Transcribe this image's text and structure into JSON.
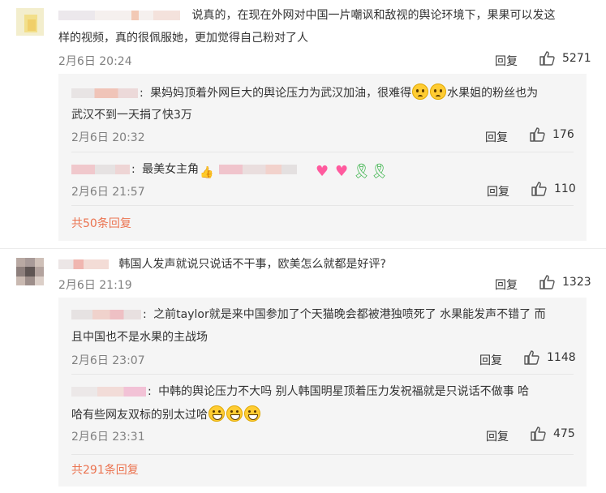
{
  "reply_label": "回复",
  "comments": [
    {
      "text_line1": "说真的，在现在外网对中国一片嘲讽和敌视的舆论环境下，果果可以发这",
      "text_line2": "样的视频，真的很佩服她，更加觉得自己粉对了人",
      "time": "2月6日 20:24",
      "likes": "5271",
      "replies": [
        {
          "text_line1": "果妈妈顶着外网巨大的舆论压力为武汉加油，很难得",
          "text_line1_after": "水果姐的粉丝也为",
          "text_line2": "武汉不到一天捐了快3万",
          "time": "2月6日 20:32",
          "likes": "176"
        },
        {
          "text_line1": "最美女主角",
          "time": "2月6日 21:57",
          "likes": "110"
        }
      ],
      "more_replies": "共50条回复"
    },
    {
      "text_line1": "韩国人发声就说只说话不干事，欧美怎么就都是好评?",
      "time": "2月6日 21:19",
      "likes": "1323",
      "replies": [
        {
          "text_line1": "之前taylor就是来中国参加了个天猫晚会都被港独喷死了 水果能发声不错了 而",
          "text_line2": "且中国也不是水果的主战场",
          "time": "2月6日 23:07",
          "likes": "1148"
        },
        {
          "text_line1": "中韩的舆论压力不大吗 别人韩国明星顶着压力发祝福就是只说话不做事 哈",
          "text_line2": "哈有些网友双标的别太过哈",
          "time": "2月6日 23:31",
          "likes": "475"
        }
      ],
      "more_replies": "共291条回复"
    }
  ],
  "colors": {
    "link_orange": "#eb7350",
    "meta_gray": "#808080",
    "reply_bg": "#f5f5f5"
  }
}
